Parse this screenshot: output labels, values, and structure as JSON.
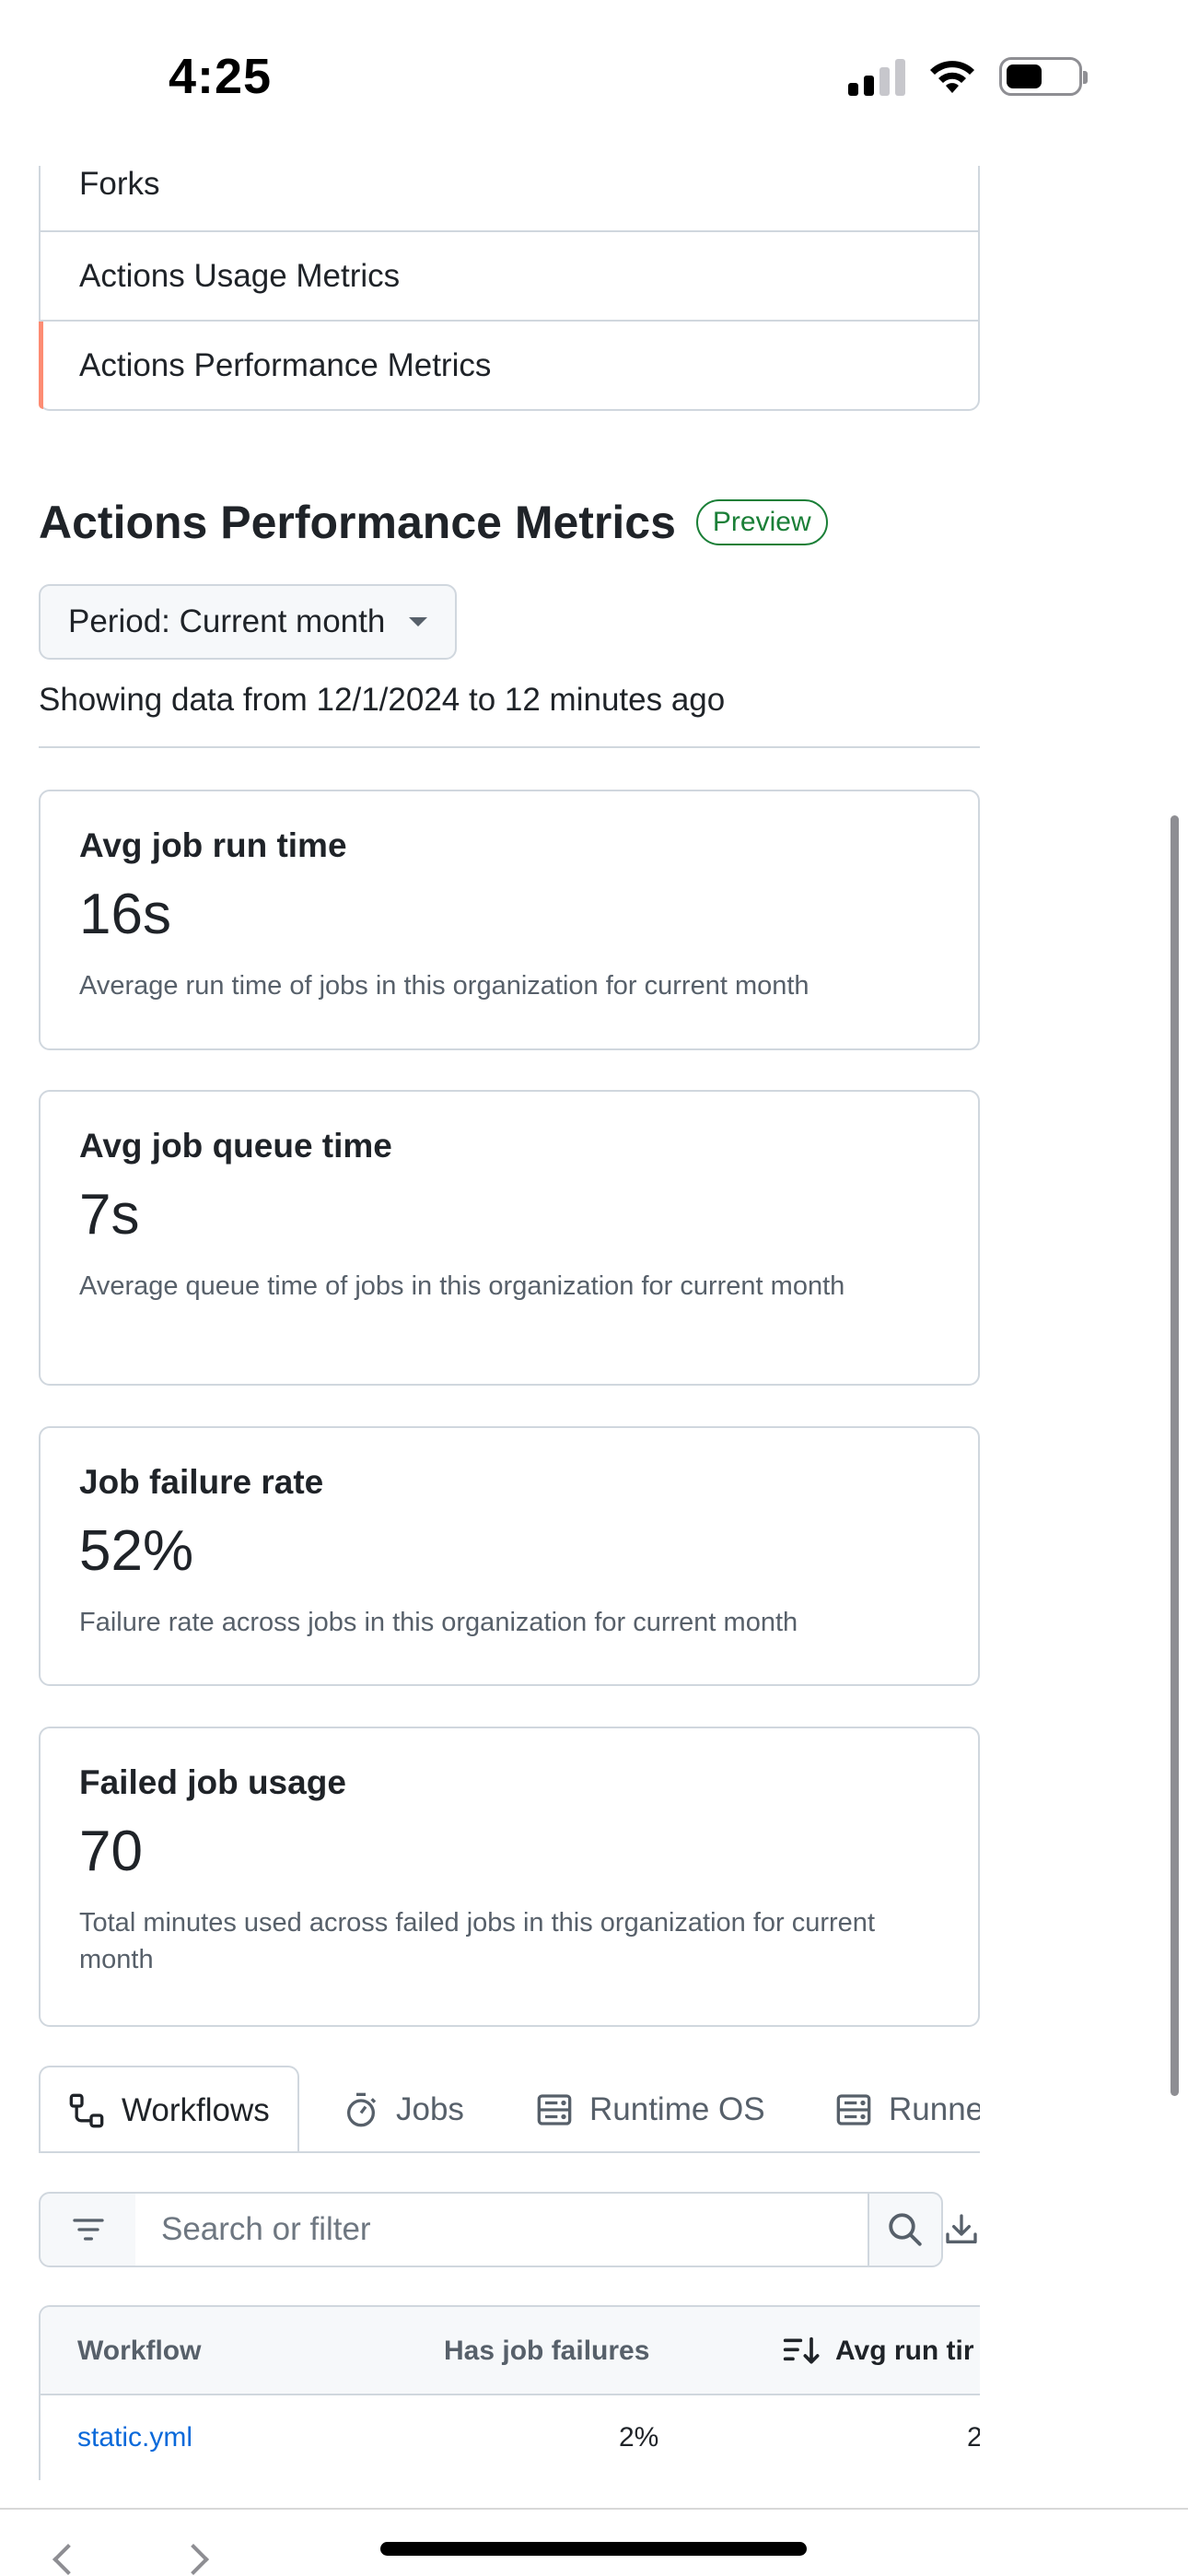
{
  "status_bar": {
    "time": "4:25"
  },
  "nav": {
    "items": [
      {
        "label": "Forks",
        "active": false
      },
      {
        "label": "Actions Usage Metrics",
        "active": false
      },
      {
        "label": "Actions Performance Metrics",
        "active": true
      }
    ]
  },
  "header": {
    "title": "Actions Performance Metrics",
    "badge": "Preview"
  },
  "period": {
    "label": "Period: Current month",
    "range_text": "Showing data from 12/1/2024 to 12 minutes ago"
  },
  "metrics": [
    {
      "title": "Avg job run time",
      "value": "16s",
      "description": "Average run time of jobs in this organization for current month"
    },
    {
      "title": "Avg job queue time",
      "value": "7s",
      "description": "Average queue time of jobs in this organization for current month"
    },
    {
      "title": "Job failure rate",
      "value": "52%",
      "description": "Failure rate across jobs in this organization for current month"
    },
    {
      "title": "Failed job usage",
      "value": "70",
      "description": "Total minutes used across failed jobs in this organization for current month"
    }
  ],
  "tabs": [
    {
      "label": "Workflows",
      "icon": "workflow-icon",
      "selected": true
    },
    {
      "label": "Jobs",
      "icon": "stopwatch-icon",
      "selected": false
    },
    {
      "label": "Runtime OS",
      "icon": "server-icon",
      "selected": false
    },
    {
      "label": "Runne",
      "icon": "server-icon",
      "selected": false
    }
  ],
  "search": {
    "placeholder": "Search or filter"
  },
  "table": {
    "columns": [
      "Workflow",
      "Has job failures",
      "Avg run tir"
    ],
    "rows": [
      {
        "workflow": "static.yml",
        "has_job_failures": "2%",
        "avg_run_time": "2"
      }
    ]
  },
  "colors": {
    "accent_active": "#fd8c73",
    "badge_green": "#1a7f37",
    "link_blue": "#0969da",
    "border": "#d0d7de"
  }
}
